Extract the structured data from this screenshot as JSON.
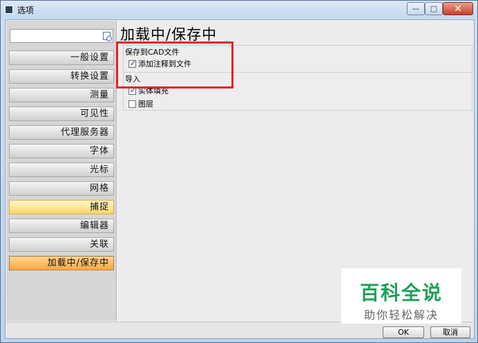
{
  "window": {
    "title": "选项",
    "minimize_glyph": "—",
    "maximize_glyph": "□",
    "close_glyph": "✕"
  },
  "search": {
    "value": "",
    "placeholder": ""
  },
  "sidebar": {
    "items": [
      {
        "label": "一般设置"
      },
      {
        "label": "转换设置"
      },
      {
        "label": "测量"
      },
      {
        "label": "可见性"
      },
      {
        "label": "代理服务器"
      },
      {
        "label": "字体"
      },
      {
        "label": "光标"
      },
      {
        "label": "网格"
      },
      {
        "label": "捕捉"
      },
      {
        "label": "编辑器"
      },
      {
        "label": "关联"
      },
      {
        "label": "加载中/保存中"
      }
    ],
    "hover_index": 8,
    "active_index": 11
  },
  "main": {
    "title": "加载中/保存中",
    "save_group": {
      "title": "保存到CAD文件",
      "options": [
        {
          "label": "添加注释到文件",
          "checked": true
        }
      ]
    },
    "import_group": {
      "title": "导入",
      "options": [
        {
          "label": "实体填充",
          "checked": true
        },
        {
          "label": "图层",
          "checked": false
        }
      ]
    }
  },
  "buttons": {
    "ok": "OK",
    "cancel": "取消"
  },
  "watermark": {
    "title": "百科全说",
    "subtitle": "助你轻松解决"
  },
  "colors": {
    "highlight": "#e8202a",
    "active": "#ffa83c",
    "hover": "#ffd66a",
    "watermark": "#1ea05a"
  }
}
